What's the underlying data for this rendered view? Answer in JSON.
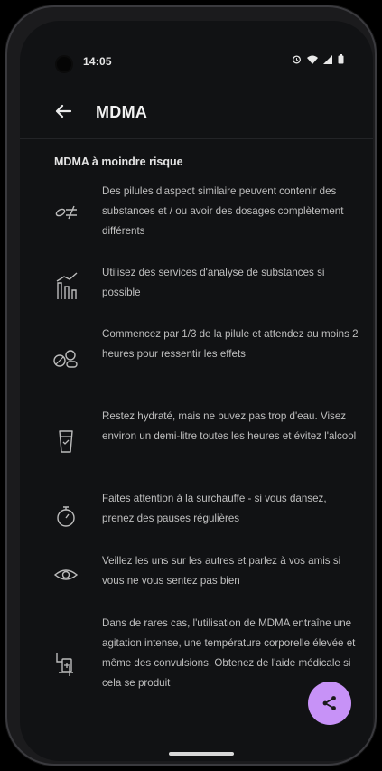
{
  "status_bar": {
    "time": "14:05"
  },
  "app_bar": {
    "title": "MDMA"
  },
  "section": {
    "heading": "MDMA à moindre risque"
  },
  "tips": [
    {
      "icon": "not-equal-pill-icon",
      "text": "Des pilules d'aspect similaire peuvent contenir des substances et / ou avoir des dosages complètement différents"
    },
    {
      "icon": "lab-analysis-icon",
      "text": "Utilisez des services d'analyse de substances si possible"
    },
    {
      "icon": "pills-icon",
      "text": "Commencez par 1/3 de la pilule et attendez au moins 2 heures pour ressentir les effets"
    },
    {
      "icon": "water-glass-icon",
      "text": "Restez hydraté, mais ne buvez pas trop d'eau. Visez environ un demi-litre toutes les heures et évitez l'alcool"
    },
    {
      "icon": "timer-icon",
      "text": "Faites attention à la surchauffe - si vous dansez, prenez des pauses régulières"
    },
    {
      "icon": "eye-icon",
      "text": "Veillez les uns sur les autres et parlez à vos amis si vous ne vous sentez pas bien"
    },
    {
      "icon": "medical-help-icon",
      "text": "Dans de rares cas, l'utilisation de MDMA entraîne une agitation intense, une température corporelle élevée et même des convulsions. Obtenez de l'aide médicale si cela se produit"
    }
  ],
  "colors": {
    "background": "#111214",
    "accent": "#c792f7",
    "text": "#bfbfbf"
  }
}
